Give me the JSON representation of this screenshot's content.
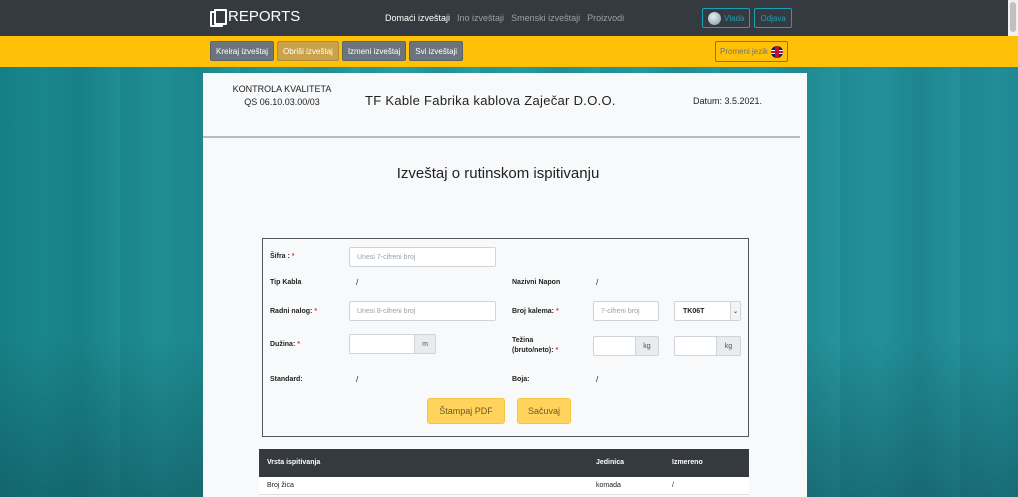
{
  "navbar": {
    "brand": "REPORTS",
    "links": [
      "Domaći izveštaji",
      "Ino izveštaji",
      "Smenski izveštaji",
      "Proizvodi"
    ],
    "user": "Vlada",
    "logout": "Odjava"
  },
  "toolbar": {
    "buttons": [
      "Kreiraj izveštaj",
      "Obriši izveštaj",
      "Izmeni izveštaj",
      "Svi izveštaji"
    ],
    "language": "Promeni jezik"
  },
  "header": {
    "left_line1": "KONTROLA KVALITETA",
    "left_line2": "QS 06.10.03.00/03",
    "company": "TF Kable Fabrika kablova Zaječar D.O.O.",
    "date": "Datum: 3.5.2021."
  },
  "title": "Izveštaj o rutinskom ispitivanju",
  "form": {
    "sifra_label": "Šifra :",
    "sifra_placeholder": "Unesi 7-cifreni broj",
    "tip_kabla_label": "Tip Kabla",
    "tip_kabla_value": "/",
    "nazivni_napon_label": "Nazivni Napon",
    "nazivni_napon_value": "/",
    "radni_nalog_label": "Radni nalog:",
    "radni_nalog_placeholder": "Unesi 8-cifreni broj",
    "broj_kalema_label": "Broj kalema:",
    "broj_kalema_placeholder": "7-cifreni broj",
    "kalem_select": "TK06T",
    "duzina_label": "Dužina:",
    "duzina_unit": "m",
    "tezina_label_1": "Težina",
    "tezina_label_2": "(bruto/neto):",
    "tezina_unit": "kg",
    "standard_label": "Standard:",
    "standard_value": "/",
    "boja_label": "Boja:",
    "boja_value": "/",
    "print_button": "Štampaj PDF",
    "save_button": "Sačuvaj",
    "required_mark": "*"
  },
  "table": {
    "headers": [
      "Vrsta ispitivanja",
      "Jedinica",
      "Izmereno"
    ],
    "rows": [
      [
        "Broj žica",
        "komada",
        "/"
      ]
    ]
  }
}
